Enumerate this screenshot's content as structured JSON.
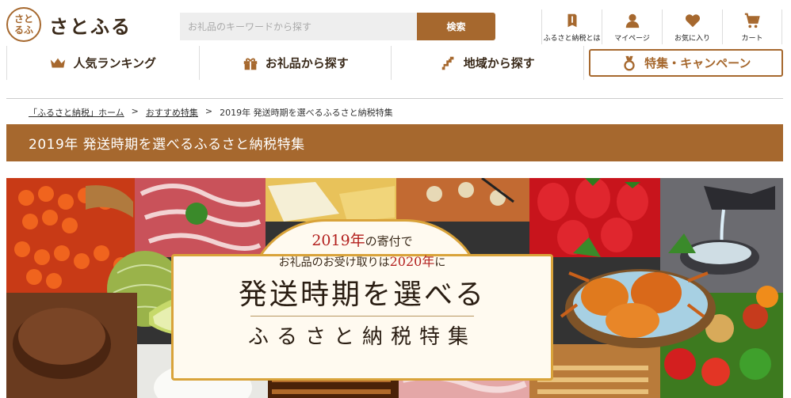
{
  "brand": {
    "logo_mark": "さと\nるふ",
    "name": "さとふる"
  },
  "search": {
    "placeholder": "お礼品のキーワードから探す",
    "button_label": "検索"
  },
  "utility_menu": [
    {
      "label": "ふるさと納税とは",
      "icon": "book-icon"
    },
    {
      "label": "マイページ",
      "icon": "user-icon"
    },
    {
      "label": "お気に入り",
      "icon": "heart-icon"
    },
    {
      "label": "カート",
      "icon": "cart-icon"
    }
  ],
  "nav": [
    {
      "label": "人気ランキング",
      "icon": "crown-icon"
    },
    {
      "label": "お礼品から探す",
      "icon": "gift-icon"
    },
    {
      "label": "地域から探す",
      "icon": "region-icon"
    },
    {
      "label": "特集・キャンペーン",
      "icon": "medal-icon"
    }
  ],
  "breadcrumb": {
    "home": "「ふるさと納税」ホーム",
    "sep1": ">",
    "parent": "おすすめ特集",
    "sep2": ">",
    "current": "2019年 発送時期を選べるふるさと納税特集"
  },
  "page_title": "2019年 発送時期を選べるふるさと納税特集",
  "hero": {
    "line1_a": "2019年",
    "line1_b": "の寄付で",
    "line2_a": "お礼品のお受け取りは",
    "line2_b": "2020年",
    "line2_c": "に",
    "title": "発送時期を選べる",
    "subtitle": "ふるさと納税特集"
  },
  "colors": {
    "brand_brown": "#a6682e",
    "accent_red": "#b3201e",
    "frame_gold": "#d9a33a"
  }
}
